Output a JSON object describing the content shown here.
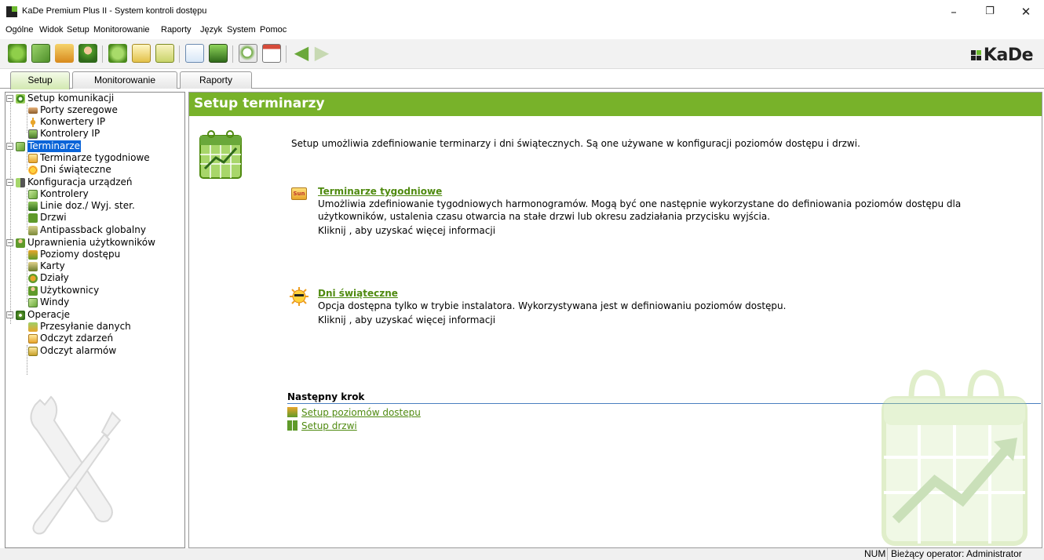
{
  "window": {
    "title": "KaDe Premium Plus II - System kontroli dostępu",
    "controls": {
      "minimize": "–",
      "maximize": "❐",
      "close": "✕"
    }
  },
  "menu": [
    "Ogólne",
    "Widok",
    "Setup",
    "Monitorowanie",
    "Raporty",
    "Język",
    "System",
    "Pomoc"
  ],
  "toolbar": {
    "buttons": [
      "communication-icon",
      "terminarze-icon",
      "devices-icon",
      "users-icon",
      "operations-icon",
      "cards-icon",
      "events-icon",
      "report-icon",
      "monitor-icon",
      "search-icon",
      "calendar-icon",
      "back-arrow-icon",
      "forward-arrow-icon"
    ],
    "logo_text": "KaDe"
  },
  "tabs": [
    "Setup",
    "Monitorowanie",
    "Raporty"
  ],
  "tree": [
    {
      "label": "Setup komunikacji",
      "level": 0,
      "expander": "−",
      "icon": "globe-icon"
    },
    {
      "label": "Porty szeregowe",
      "level": 1,
      "icon": "serial-port-icon"
    },
    {
      "label": "Konwertery IP",
      "level": 1,
      "icon": "converter-icon"
    },
    {
      "label": "Kontrolery IP",
      "level": 1,
      "icon": "controller-ip-icon"
    },
    {
      "label": "Terminarze",
      "level": 0,
      "expander": "−",
      "icon": "calendar-icon",
      "selected": true
    },
    {
      "label": "Terminarze tygodniowe",
      "level": 1,
      "icon": "weekly-schedule-icon"
    },
    {
      "label": "Dni świąteczne",
      "level": 1,
      "icon": "sun-icon"
    },
    {
      "label": "Konfiguracja urządzeń",
      "level": 0,
      "expander": "−",
      "icon": "device-config-icon"
    },
    {
      "label": "Kontrolery",
      "level": 1,
      "icon": "controller-icon"
    },
    {
      "label": "Linie doz./ Wyj. ster.",
      "level": 1,
      "icon": "line-icon"
    },
    {
      "label": "Drzwi",
      "level": 1,
      "icon": "door-icon"
    },
    {
      "label": "Antipassback globalny",
      "level": 1,
      "icon": "antipassback-icon"
    },
    {
      "label": "Uprawnienia użytkowników",
      "level": 0,
      "expander": "−",
      "icon": "user-permissions-icon"
    },
    {
      "label": "Poziomy dostępu",
      "level": 1,
      "icon": "access-level-icon"
    },
    {
      "label": "Karty",
      "level": 1,
      "icon": "card-icon"
    },
    {
      "label": "Działy",
      "level": 1,
      "icon": "departments-icon"
    },
    {
      "label": "Użytkownicy",
      "level": 1,
      "icon": "users-icon"
    },
    {
      "label": "Windy",
      "level": 1,
      "icon": "elevator-icon"
    },
    {
      "label": "Operacje",
      "level": 0,
      "expander": "−",
      "icon": "operations-icon"
    },
    {
      "label": "Przesyłanie danych",
      "level": 1,
      "icon": "data-transfer-icon"
    },
    {
      "label": "Odczyt zdarzeń",
      "level": 1,
      "icon": "events-read-icon"
    },
    {
      "label": "Odczyt alarmów",
      "level": 1,
      "icon": "alarms-read-icon"
    }
  ],
  "content": {
    "title": "Setup terminarzy",
    "intro": "Setup umożliwia zdefiniowanie terminarzy i dni świątecznych. Są one używane w konfiguracji poziomów dostępu i drzwi.",
    "sections": [
      {
        "title": "Terminarze tygodniowe",
        "icon_label": "Sun",
        "lines": [
          "Umożliwia zdefiniowanie tygodniowych harmonogramów. Mogą być one następnie wykorzystane do definiowania poziomów dostępu dla",
          "użytkowników, ustalenia czasu otwarcia na stałe drzwi lub okresu zadziałania przycisku wyjścia.",
          "Kliknij , aby uzyskać więcej informacji"
        ]
      },
      {
        "title": "Dni świąteczne",
        "lines": [
          "Opcja dostępna tylko w trybie instalatora. Wykorzystywana jest w definiowaniu poziomów dostępu.",
          "Kliknij , aby uzyskać więcej informacji"
        ]
      }
    ],
    "next_step": {
      "title": "Następny krok",
      "links": [
        "Setup poziomów dostepu",
        "Setup drzwi"
      ]
    }
  },
  "status": {
    "num": "NUM",
    "operator": "Bieżący operator: Administrator"
  },
  "colors": {
    "header_green": "#78b22a",
    "link_green": "#4f8a10",
    "selection_blue": "#0a64d8",
    "next_line_blue": "#4a7fc0"
  }
}
